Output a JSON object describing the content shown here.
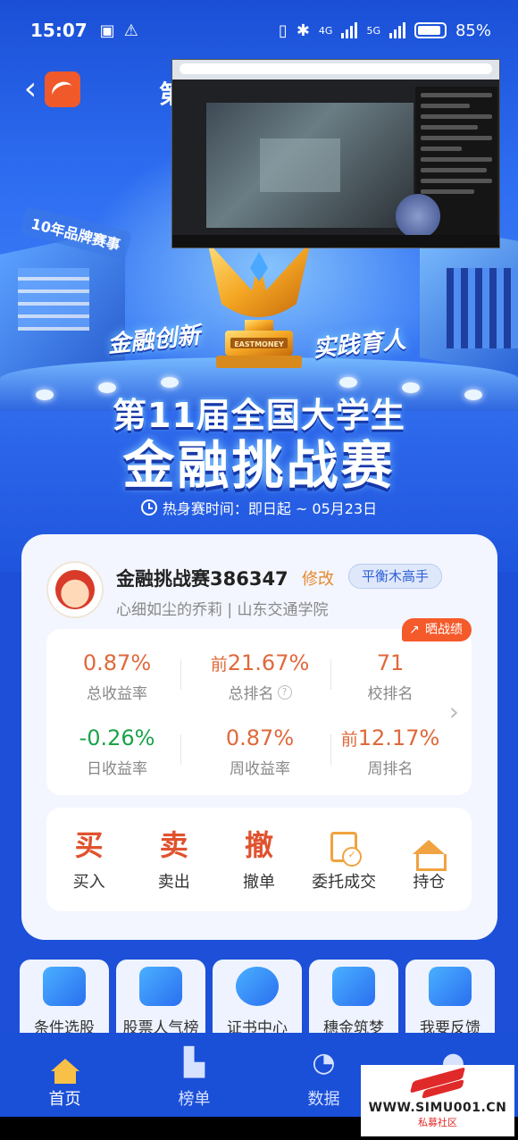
{
  "status_bar": {
    "time": "15:07",
    "signal_4g": "4G",
    "signal_5g": "5G",
    "battery": "85%",
    "battery_level": 0.85
  },
  "header": {
    "back_icon": "chevron-left-icon",
    "app_logo": "eastmoney-logo",
    "title_partial": "第"
  },
  "hero": {
    "ribbon_text": "10年品牌赛事",
    "slogan_left": "金融创新",
    "slogan_right": "实践育人",
    "trophy_label": "EASTMONEY",
    "title_line1": "第11届全国大学生",
    "title_line2": "金融挑战赛",
    "warmup_label": "热身赛时间：即日起 ~ 05月23日"
  },
  "profile": {
    "username": "金融挑战赛386347",
    "edit_label": "修改",
    "level_badge": "平衡木高手",
    "subline": "心细如尘的乔莉 | 山东交通学院"
  },
  "stats": {
    "share_label": "晒战绩",
    "items": [
      {
        "prefix": "",
        "value": "0.87%",
        "label": "总收益率"
      },
      {
        "prefix": "前",
        "value": "21.67%",
        "label": "总排名"
      },
      {
        "prefix": "",
        "value": "71",
        "label": "校排名"
      },
      {
        "prefix": "",
        "value": "-0.26%",
        "label": "日收益率"
      },
      {
        "prefix": "",
        "value": "0.87%",
        "label": "周收益率"
      },
      {
        "prefix": "前",
        "value": "12.17%",
        "label": "周排名"
      }
    ],
    "help_icon": "question-icon",
    "chevron_icon": "chevron-right-icon"
  },
  "actions": [
    {
      "icon_char": "买",
      "label": "买入"
    },
    {
      "icon_char": "卖",
      "label": "卖出"
    },
    {
      "icon_char": "撤",
      "label": "撤单"
    },
    {
      "icon_char": "",
      "label": "委托成交"
    },
    {
      "icon_char": "",
      "label": "持仓"
    }
  ],
  "tiles": [
    {
      "label": "条件选股"
    },
    {
      "label": "股票人气榜"
    },
    {
      "label": "证书中心"
    },
    {
      "label": "穗金筑梦"
    },
    {
      "label": "我要反馈"
    }
  ],
  "bottom_nav": [
    {
      "label": "首页",
      "active": true
    },
    {
      "label": "榜单",
      "active": false
    },
    {
      "label": "数据",
      "active": false
    },
    {
      "label": "",
      "active": false
    }
  ],
  "watermark": {
    "url": "WWW.SIMU001.CN",
    "sub": "私募社区"
  },
  "colors": {
    "accent_orange": "#e0683a",
    "positive_green": "#1aa34a",
    "brand_blue": "#1a4fd8",
    "share_red": "#f55a2a"
  }
}
